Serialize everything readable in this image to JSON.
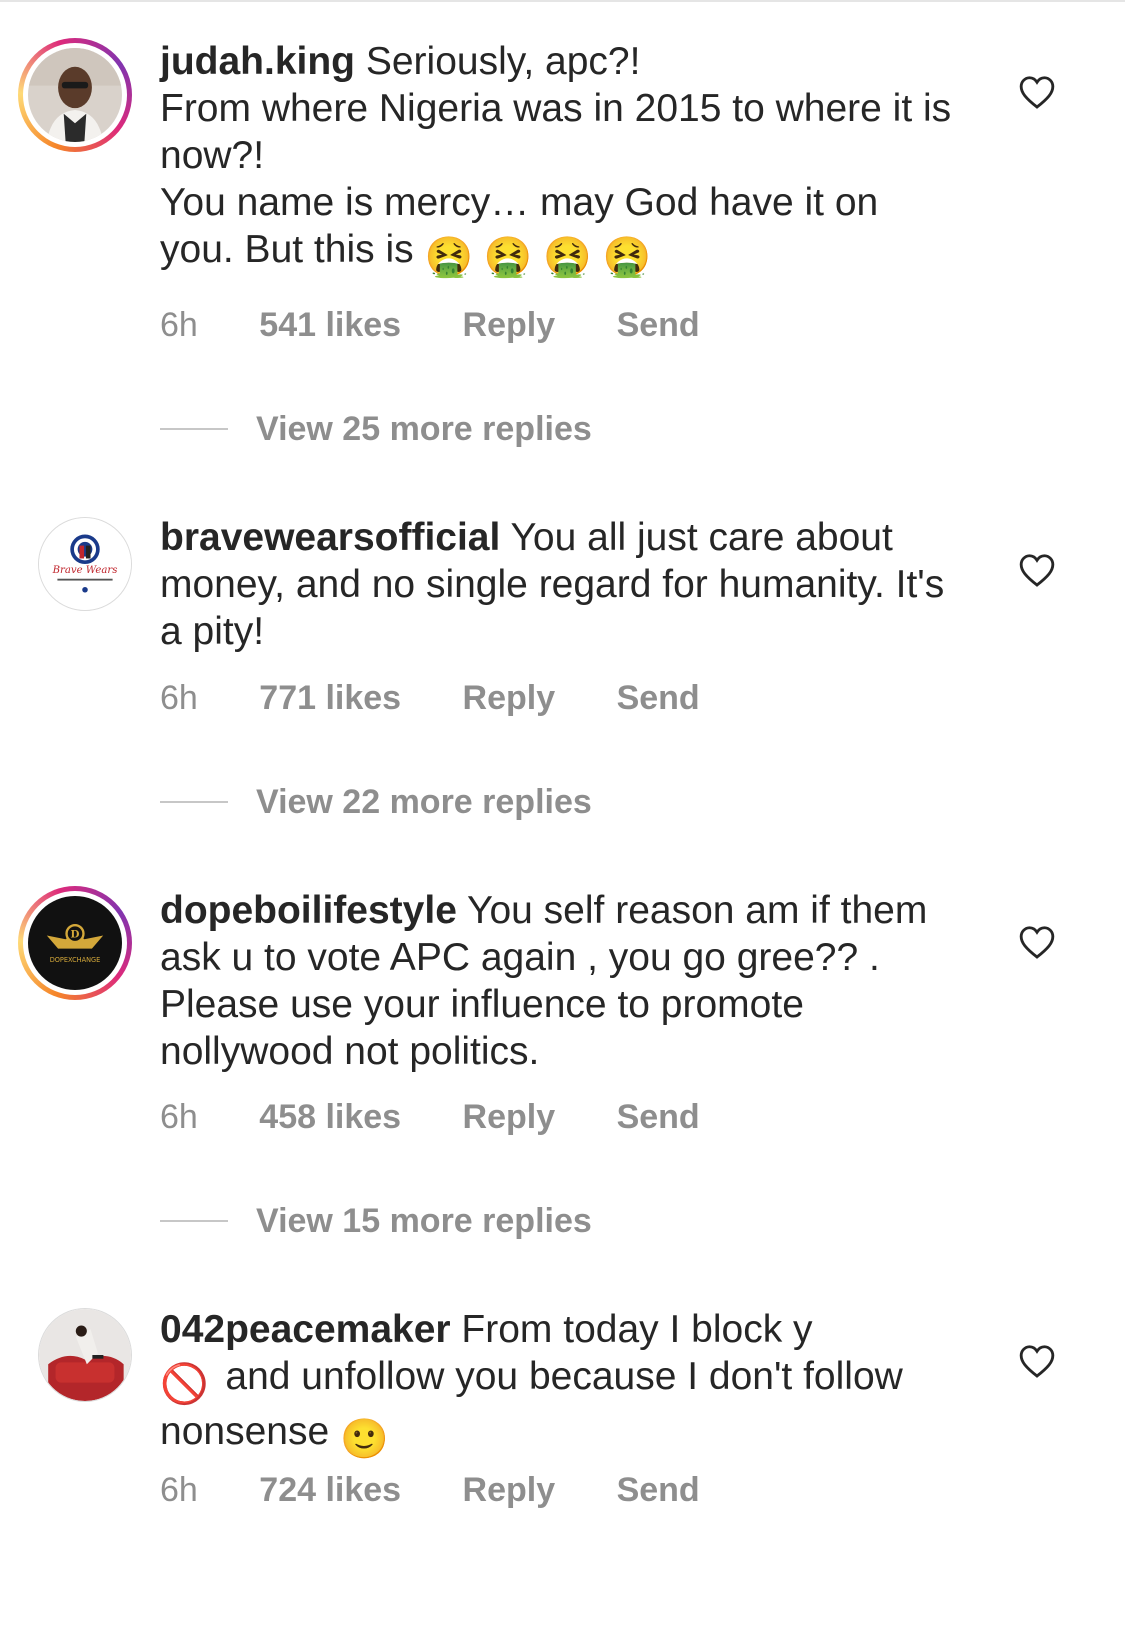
{
  "comments": [
    {
      "username": "judah.king",
      "text_lines": [
        "Seriously, apc?!",
        "From where Nigeria was in 2015 to where it is now?!",
        "You name is mercy… may God have it on you. But this is"
      ],
      "emoji_trailing": "🤮 🤮 🤮 🤮",
      "time": "6h",
      "likes": "541 likes",
      "reply": "Reply",
      "send": "Send",
      "view_more": "View 25 more replies",
      "avatar": "story-ring"
    },
    {
      "username": "bravewearsofficial",
      "text": "You all just care about money, and no single regard for humanity. It's a pity!",
      "time": "6h",
      "likes": "771 likes",
      "reply": "Reply",
      "send": "Send",
      "view_more": "View 22 more replies",
      "avatar": "plain",
      "avatar_text": "Brave Wears"
    },
    {
      "username": "dopeboilifestyle",
      "text": "You self reason am if them ask u to vote APC again , you go gree?? . Please use your influence to promote nollywood not politics.",
      "time": "6h",
      "likes": "458 likes",
      "reply": "Reply",
      "send": "Send",
      "view_more": "View 15 more replies",
      "avatar": "story-ring",
      "avatar_text": "DOPEXCHANGE"
    },
    {
      "username": "042peacemaker",
      "text_before_emoji": "From today I block y",
      "emoji_mid": "🚫",
      "text_after_emoji": "and unfollow you  because I don't follow nonsense",
      "emoji_trailing": "🙂",
      "time": "6h",
      "likes": "724 likes",
      "reply": "Reply",
      "send": "Send",
      "avatar": "plain"
    }
  ],
  "icons": {
    "like": "heart-outline-icon"
  },
  "colors": {
    "text": "#262626",
    "secondary": "#8e8e8e",
    "divider": "#c7c7c7"
  }
}
